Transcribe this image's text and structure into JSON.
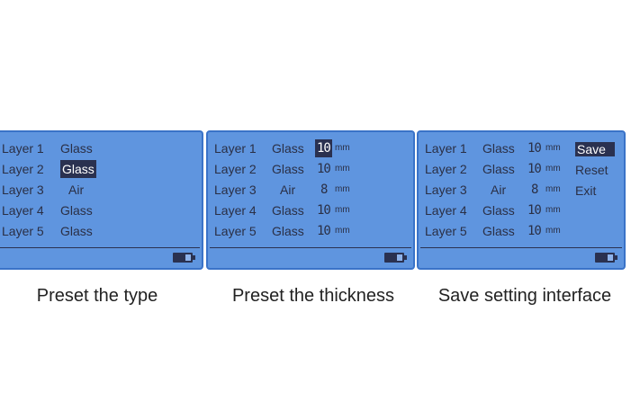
{
  "panels": [
    {
      "rows": [
        {
          "label": "Layer 1",
          "material": "Glass",
          "highlight": false
        },
        {
          "label": "Layer 2",
          "material": "Glass",
          "highlight": true
        },
        {
          "label": "Layer 3",
          "material": "Air",
          "highlight": false
        },
        {
          "label": "Layer 4",
          "material": "Glass",
          "highlight": false
        },
        {
          "label": "Layer 5",
          "material": "Glass",
          "highlight": false
        }
      ],
      "caption": "Preset the type"
    },
    {
      "rows": [
        {
          "label": "Layer 1",
          "material": "Glass",
          "thickness": "10",
          "unit": "mm",
          "highlight": true
        },
        {
          "label": "Layer 2",
          "material": "Glass",
          "thickness": "10",
          "unit": "mm",
          "highlight": false
        },
        {
          "label": "Layer 3",
          "material": "Air",
          "thickness": "8",
          "unit": "mm",
          "highlight": false
        },
        {
          "label": "Layer 4",
          "material": "Glass",
          "thickness": "10",
          "unit": "mm",
          "highlight": false
        },
        {
          "label": "Layer 5",
          "material": "Glass",
          "thickness": "10",
          "unit": "mm",
          "highlight": false
        }
      ],
      "caption": "Preset the thickness"
    },
    {
      "rows": [
        {
          "label": "Layer 1",
          "material": "Glass",
          "thickness": "10",
          "unit": "mm"
        },
        {
          "label": "Layer 2",
          "material": "Glass",
          "thickness": "10",
          "unit": "mm"
        },
        {
          "label": "Layer 3",
          "material": "Air",
          "thickness": "8",
          "unit": "mm"
        },
        {
          "label": "Layer 4",
          "material": "Glass",
          "thickness": "10",
          "unit": "mm"
        },
        {
          "label": "Layer 5",
          "material": "Glass",
          "thickness": "10",
          "unit": "mm"
        }
      ],
      "menu": [
        "Save",
        "Reset",
        "Exit"
      ],
      "menu_selected": "Save",
      "caption": "Save setting interface"
    }
  ],
  "colors": {
    "screen_bg": "#5f95df",
    "screen_border": "#3a73c8",
    "text": "#2a2f45",
    "highlight": "#2a3150"
  },
  "icons": {
    "battery": "battery-icon"
  }
}
